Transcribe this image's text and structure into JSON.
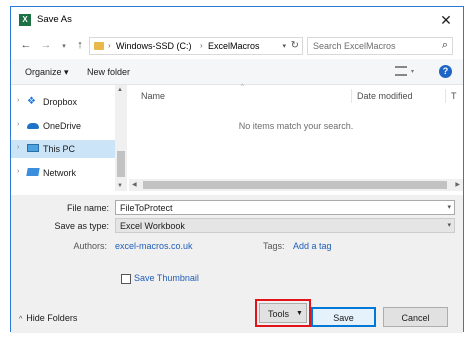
{
  "window": {
    "title": "Save As",
    "accent": "#2b79d8"
  },
  "nav": {
    "breadcrumbs": [
      "Windows-SSD (C:)",
      "ExcelMacros"
    ],
    "search_placeholder": "Search ExcelMacros"
  },
  "toolbar": {
    "organize": "Organize",
    "new_folder": "New folder"
  },
  "sidebar": {
    "items": [
      {
        "label": "Dropbox",
        "icon": "dropbox-icon",
        "selected": false
      },
      {
        "label": "OneDrive",
        "icon": "onedrive-icon",
        "selected": false
      },
      {
        "label": "This PC",
        "icon": "pc-icon",
        "selected": true
      },
      {
        "label": "Network",
        "icon": "network-icon",
        "selected": false
      }
    ]
  },
  "filelist": {
    "columns": [
      "Name",
      "Date modified",
      "T"
    ],
    "empty_message": "No items match your search."
  },
  "form": {
    "filename_label": "File name:",
    "filename_value": "FileToProtect",
    "type_label": "Save as type:",
    "type_value": "Excel Workbook",
    "authors_label": "Authors:",
    "authors_value": "excel-macros.co.uk",
    "tags_label": "Tags:",
    "tags_value": "Add a tag",
    "thumbnail_label": "Save Thumbnail",
    "thumbnail_checked": false
  },
  "footer": {
    "hide_folders": "Hide Folders",
    "tools": "Tools",
    "save": "Save",
    "cancel": "Cancel",
    "highlight_color": "#e3131a"
  }
}
